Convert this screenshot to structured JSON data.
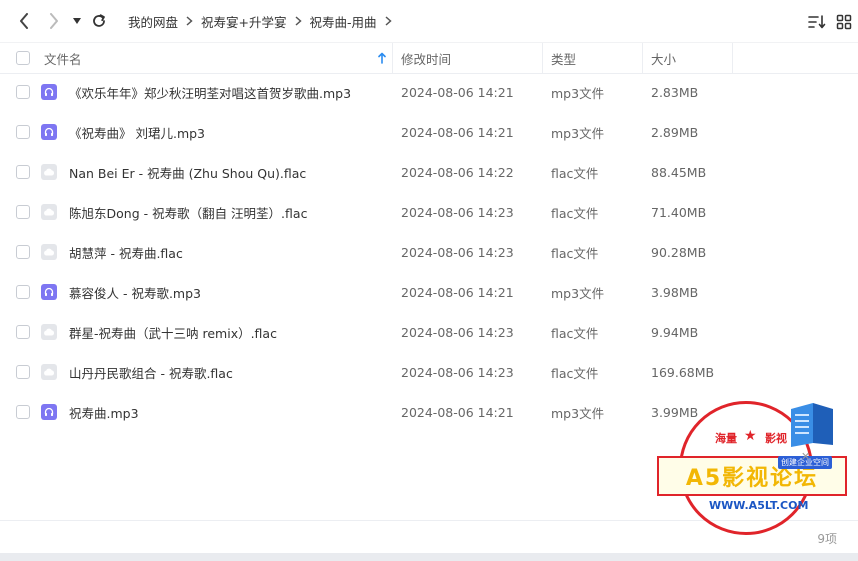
{
  "breadcrumb": [
    "我的网盘",
    "祝寿宴+升学宴",
    "祝寿曲-用曲"
  ],
  "columns": {
    "name": "文件名",
    "modified": "修改时间",
    "type": "类型",
    "size": "大小"
  },
  "files": [
    {
      "name": "《欢乐年年》郑少秋汪明荃对唱这首贺岁歌曲.mp3",
      "modified": "2024-08-06 14:21",
      "type": "mp3文件",
      "size": "2.83MB",
      "icon": "audio-file-icon"
    },
    {
      "name": "《祝寿曲》 刘珺儿.mp3",
      "modified": "2024-08-06 14:21",
      "type": "mp3文件",
      "size": "2.89MB",
      "icon": "audio-file-icon"
    },
    {
      "name": "Nan Bei Er - 祝寿曲 (Zhu Shou Qu).flac",
      "modified": "2024-08-06 14:22",
      "type": "flac文件",
      "size": "88.45MB",
      "icon": "cloud-file-icon"
    },
    {
      "name": "陈旭东Dong - 祝寿歌（翻自 汪明荃）.flac",
      "modified": "2024-08-06 14:23",
      "type": "flac文件",
      "size": "71.40MB",
      "icon": "cloud-file-icon"
    },
    {
      "name": "胡慧萍 - 祝寿曲.flac",
      "modified": "2024-08-06 14:23",
      "type": "flac文件",
      "size": "90.28MB",
      "icon": "cloud-file-icon"
    },
    {
      "name": "慕容俊人 - 祝寿歌.mp3",
      "modified": "2024-08-06 14:21",
      "type": "mp3文件",
      "size": "3.98MB",
      "icon": "audio-file-icon"
    },
    {
      "name": "群星-祝寿曲（武十三呐 remix）.flac",
      "modified": "2024-08-06 14:23",
      "type": "flac文件",
      "size": "9.94MB",
      "icon": "cloud-file-icon"
    },
    {
      "name": "山丹丹民歌组合 - 祝寿歌.flac",
      "modified": "2024-08-06 14:23",
      "type": "flac文件",
      "size": "169.68MB",
      "icon": "cloud-file-icon"
    },
    {
      "name": "祝寿曲.mp3",
      "modified": "2024-08-06 14:21",
      "type": "mp3文件",
      "size": "3.99MB",
      "icon": "audio-file-icon"
    }
  ],
  "footer": {
    "count": "9项"
  },
  "watermark": {
    "top_left": "海量",
    "top_right": "影视",
    "main": "A5影视论坛",
    "tag": "创建企业空间",
    "url": "WWW.A5LT.COM"
  },
  "colors": {
    "accent": "#2b8cf0",
    "audio_icon": "#7e76f2",
    "flac_icon": "#e4e6ea",
    "stamp_red": "#e0242a"
  }
}
